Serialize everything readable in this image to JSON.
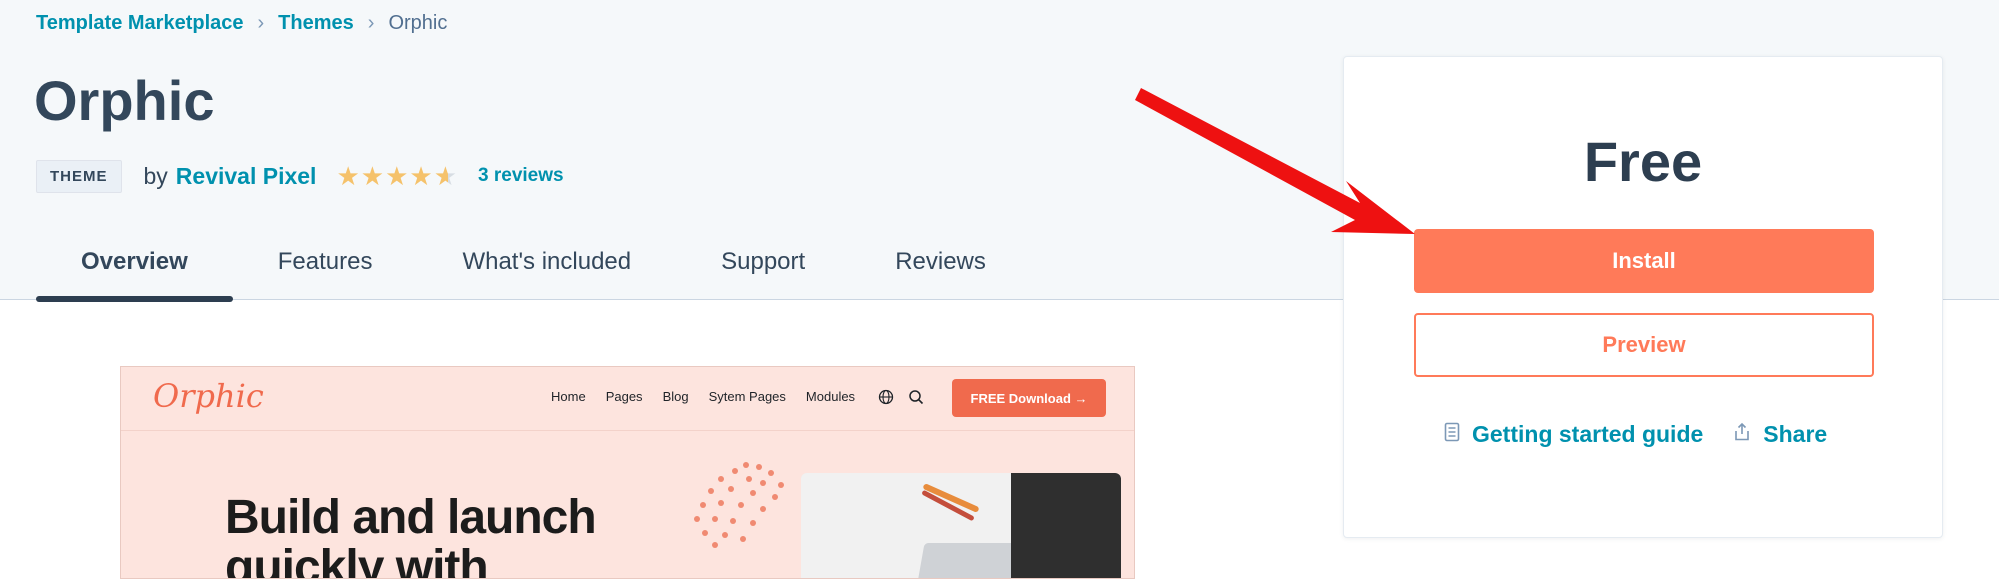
{
  "breadcrumb": {
    "items": [
      "Template Marketplace",
      "Themes"
    ],
    "current": "Orphic",
    "separator": "›"
  },
  "page": {
    "title": "Orphic",
    "tag": "THEME",
    "by_label": "by",
    "author": "Revival Pixel",
    "rating": 4.5,
    "rating_max": 5,
    "reviews_link": "3 reviews"
  },
  "tabs": [
    {
      "label": "Overview",
      "active": true
    },
    {
      "label": "Features",
      "active": false
    },
    {
      "label": "What's included",
      "active": false
    },
    {
      "label": "Support",
      "active": false
    },
    {
      "label": "Reviews",
      "active": false
    }
  ],
  "preview_image": {
    "logo": "Orphic",
    "menu": [
      "Home",
      "Pages",
      "Blog",
      "Sytem Pages",
      "Modules"
    ],
    "cta": "FREE Download  →",
    "hero_line1": "Build and launch",
    "hero_line2": "quickly with"
  },
  "pricing": {
    "price": "Free",
    "install_label": "Install",
    "preview_label": "Preview",
    "guide_label": "Getting started guide",
    "share_label": "Share"
  },
  "colors": {
    "accent": "#ff7a59",
    "link": "#0091ae",
    "text": "#33475b",
    "annotation_arrow": "#ee1111"
  },
  "icons": {
    "guide": "document-icon",
    "share": "share-icon",
    "globe": "globe-icon",
    "search": "search-icon"
  }
}
